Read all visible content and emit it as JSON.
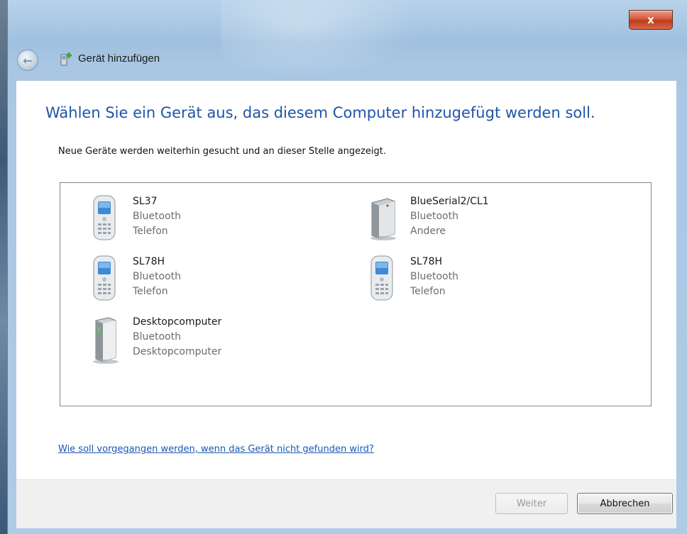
{
  "window": {
    "title": "Gerät hinzufügen",
    "close_label": "x"
  },
  "main": {
    "heading": "Wählen Sie ein Gerät aus, das diesem Computer hinzugefügt werden soll.",
    "subtext": "Neue Geräte werden weiterhin gesucht und an dieser Stelle angezeigt."
  },
  "devices": [
    {
      "name": "SL37",
      "connection": "Bluetooth",
      "type": "Telefon",
      "icon": "mobile-phone-icon"
    },
    {
      "name": "BlueSerial2/CL1",
      "connection": "Bluetooth",
      "type": "Andere",
      "icon": "generic-device-icon"
    },
    {
      "name": "SL78H",
      "connection": "Bluetooth",
      "type": "Telefon",
      "icon": "mobile-phone-icon"
    },
    {
      "name": "SL78H",
      "connection": "Bluetooth",
      "type": "Telefon",
      "icon": "mobile-phone-icon"
    },
    {
      "name": "Desktopcomputer",
      "connection": "Bluetooth",
      "type": "Desktopcomputer",
      "icon": "desktop-computer-icon"
    }
  ],
  "help_link": "Wie soll vorgegangen werden, wenn das Gerät nicht gefunden wird?",
  "buttons": {
    "next": "Weiter",
    "cancel": "Abbrechen"
  },
  "colors": {
    "heading": "#1e55a8",
    "link": "#1a56b5",
    "close_button": "#c03b1c"
  }
}
